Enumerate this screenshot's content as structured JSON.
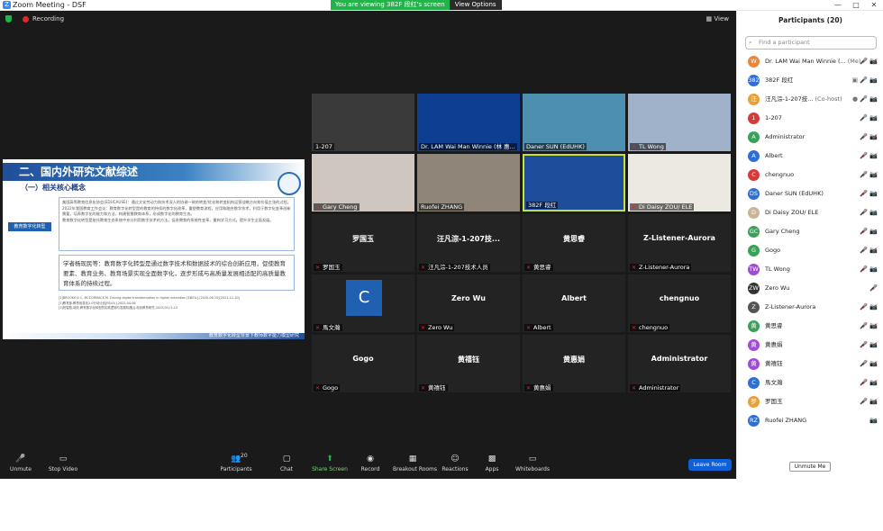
{
  "window": {
    "title": "Zoom Meeting - DSF",
    "viewing_banner": "You are viewing 382F 段红's screen",
    "view_options": "View Options",
    "controls": [
      "—",
      "□",
      "✕"
    ]
  },
  "meeting": {
    "recording_label": "Recording",
    "view_label": "View"
  },
  "slide": {
    "title": "二、国内外研究文献综述",
    "subtitle": "（一）相关核心概念",
    "tag": "教育数字化转型",
    "box1": [
      "美国高等教育信息化协会(EDUCAUSE)：通过文化劳动力和技术深入的协调一致的转变/优化和转变机构运营战略方向和价值主张的过程。",
      "2022年我国教育工作会议：教育数字化转型是的教育的持续的数字化改革，重塑教育流程，应用和融合数字技术，利用于数字化变革创新需要，培养数字化的能力和方法，构建智慧教育体系，形成数字化的教育生态。",
      "教育数字化转型是依托教育生态系统中充分利用数字技术的方法，促进教育的系统性变革，重构学习方式，提升学生全面发展。"
    ],
    "box2": "学者杨现民等：教育数字化转型是通过数字技术和数据技术的综合创新应用，促使教育要素、教育业务、教育场景实现全面数字化，逐步形成与高质量发展相适配的高质量教育体系的持续过程。",
    "refs": [
      "[1]BROOKS D C, MCCORMACK M. Driving digital transformation in higher education [EB/OL].(2020-06-15)[2021-11-10]",
      "[2]教育部.教育信息化2.0行动计划[EB/OL].2022-04-06",
      "[3]祝智庭,胡姣.教育数字化转型的实践逻辑与发展机遇[J].电化教育研究,2022(01):5-15"
    ],
    "footer": "教育数字化转型背景下教师数字能力模型研究"
  },
  "tiles": [
    {
      "name": "1-207",
      "kind": "video",
      "color": "#3a3a3a",
      "muted": false,
      "speaking": false,
      "big": ""
    },
    {
      "name": "Dr. LAM Wai Man Winnie (林 惠...",
      "kind": "video",
      "color": "#0d3e8f",
      "muted": false,
      "speaking": false,
      "big": ""
    },
    {
      "name": "Daner SUN (EdUHK)",
      "kind": "video",
      "color": "#4d8fb0",
      "muted": false,
      "speaking": false,
      "big": ""
    },
    {
      "name": "TL Wong",
      "kind": "video",
      "color": "#9fb2c9",
      "muted": true,
      "speaking": false,
      "big": ""
    },
    {
      "name": "Gary Cheng",
      "kind": "video",
      "color": "#cfc7bf",
      "muted": true,
      "speaking": false,
      "big": ""
    },
    {
      "name": "Ruofei ZHANG",
      "kind": "video",
      "color": "#8f8578",
      "muted": false,
      "speaking": false,
      "big": ""
    },
    {
      "name": "382F 段红",
      "kind": "video",
      "color": "#1e4d9c",
      "muted": false,
      "speaking": true,
      "big": ""
    },
    {
      "name": "Di Daisy ZOU/ ELE",
      "kind": "video",
      "color": "#ece9e2",
      "muted": true,
      "speaking": false,
      "big": ""
    },
    {
      "name": "罗国玉",
      "kind": "name",
      "muted": true,
      "speaking": false,
      "big": "罗国玉"
    },
    {
      "name": "汪凡淙-1-207技术人员",
      "kind": "name",
      "muted": true,
      "speaking": false,
      "big": "汪凡淙-1-207技..."
    },
    {
      "name": "黄思睿",
      "kind": "name",
      "muted": true,
      "speaking": false,
      "big": "黄思睿"
    },
    {
      "name": "Z-Listener-Aurora",
      "kind": "name",
      "muted": true,
      "speaking": false,
      "big": "Z-Listener-Aurora"
    },
    {
      "name": "馬文瀚",
      "kind": "avatar",
      "muted": true,
      "speaking": false,
      "big": "C"
    },
    {
      "name": "Zero Wu",
      "kind": "name",
      "muted": true,
      "speaking": false,
      "big": "Zero Wu"
    },
    {
      "name": "Albert",
      "kind": "name",
      "muted": true,
      "speaking": false,
      "big": "Albert"
    },
    {
      "name": "chengnuo",
      "kind": "name",
      "muted": true,
      "speaking": false,
      "big": "chengnuo"
    },
    {
      "name": "Gogo",
      "kind": "name",
      "muted": true,
      "speaking": false,
      "big": "Gogo"
    },
    {
      "name": "黄禧钰",
      "kind": "name",
      "muted": true,
      "speaking": false,
      "big": "黄禧钰"
    },
    {
      "name": "黄惠娟",
      "kind": "name",
      "muted": true,
      "speaking": false,
      "big": "黄惠娟"
    },
    {
      "name": "Administrator",
      "kind": "name",
      "muted": true,
      "speaking": false,
      "big": "Administrator"
    }
  ],
  "toolbar": {
    "unmute": "Unmute",
    "stop_video": "Stop Video",
    "participants": "Participants",
    "participants_count": "20",
    "chat": "Chat",
    "share_screen": "Share Screen",
    "record": "Record",
    "breakout": "Breakout Rooms",
    "reactions": "Reactions",
    "apps": "Apps",
    "whiteboards": "Whiteboards",
    "leave": "Leave Room"
  },
  "panel": {
    "title": "Participants (20)",
    "search_placeholder": "Find a participant",
    "mute_me": "Unmute Me",
    "participants": [
      {
        "initials": "W",
        "color": "#e8883a",
        "name": "Dr. LAM Wai Man Winnie (...",
        "role": "(Me)",
        "icons": "🎤̸ 📷̸",
        "muted": true
      },
      {
        "initials": "382",
        "color": "#2d6fd6",
        "name": "382F 段红",
        "role": "",
        "icons": "▣ 🎤 📷",
        "muted": false
      },
      {
        "initials": "汪",
        "color": "#e8a03a",
        "name": "汪凡淙-1-207技...",
        "role": "(Co-host)",
        "icons": "● 🎤 📷",
        "muted": false
      },
      {
        "initials": "1",
        "color": "#d63a3a",
        "name": "1-207",
        "role": "",
        "icons": "🎤 📷̸",
        "muted": false
      },
      {
        "initials": "A",
        "color": "#3aa05a",
        "name": "Administrator",
        "role": "",
        "icons": "🎤̸ 📷̸",
        "muted": true
      },
      {
        "initials": "A",
        "color": "#2d6fd6",
        "name": "Albert",
        "role": "",
        "icons": "🎤̸ 📷̸",
        "muted": true
      },
      {
        "initials": "C",
        "color": "#d63a3a",
        "name": "chengnuo",
        "role": "",
        "icons": "🎤̸ 📷̸",
        "muted": true
      },
      {
        "initials": "DS",
        "color": "#2d6fd6",
        "name": "Daner SUN (EdUHK)",
        "role": "",
        "icons": "🎤̸ 📷",
        "muted": true
      },
      {
        "initials": "D",
        "color": "#c9b59a",
        "name": "Di Daisy ZOU/ ELE",
        "role": "",
        "icons": "🎤̸ 📷",
        "muted": true
      },
      {
        "initials": "GC",
        "color": "#3aa05a",
        "name": "Gary Cheng",
        "role": "",
        "icons": "🎤̸ 📷",
        "muted": true
      },
      {
        "initials": "G",
        "color": "#3aa05a",
        "name": "Gogo",
        "role": "",
        "icons": "🎤̸ 📷̸",
        "muted": true
      },
      {
        "initials": "TW",
        "color": "#a04ad6",
        "name": "TL Wong",
        "role": "",
        "icons": "🎤̸ 📷",
        "muted": true
      },
      {
        "initials": "ZW",
        "color": "#333333",
        "name": "Zero Wu",
        "role": "",
        "icons": "🎤̸",
        "muted": true
      },
      {
        "initials": "Z",
        "color": "#555555",
        "name": "Z-Listener-Aurora",
        "role": "",
        "icons": "🎤̸ 📷̸",
        "muted": true
      },
      {
        "initials": "黄",
        "color": "#3aa05a",
        "name": "黄思睿",
        "role": "",
        "icons": "🎤̸ 📷̸",
        "muted": true
      },
      {
        "initials": "黄",
        "color": "#a04ad6",
        "name": "黄惠娟",
        "role": "",
        "icons": "🎤̸ 📷̸",
        "muted": true
      },
      {
        "initials": "黄",
        "color": "#a04ad6",
        "name": "黄禧钰",
        "role": "",
        "icons": "🎤̸ 📷̸",
        "muted": true
      },
      {
        "initials": "C",
        "color": "#2d6fd6",
        "name": "馬文瀚",
        "role": "",
        "icons": "🎤̸ 📷̸",
        "muted": true
      },
      {
        "initials": "罗",
        "color": "#e8a03a",
        "name": "罗国玉",
        "role": "",
        "icons": "🎤̸ 📷̸",
        "muted": true
      },
      {
        "initials": "RZ",
        "color": "#2d6fd6",
        "name": "Ruofei ZHANG",
        "role": "",
        "icons": "📷",
        "muted": false
      }
    ]
  }
}
